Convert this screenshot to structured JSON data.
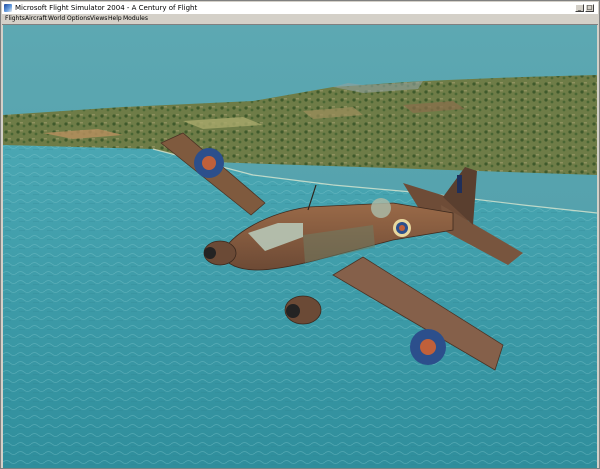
{
  "window": {
    "title": "Microsoft Flight Simulator 2004 - A Century of Flight",
    "controls": {
      "minimize": "_",
      "maximize": "□",
      "close": "×"
    }
  },
  "menu": {
    "items": [
      "Flights",
      "Aircraft",
      "World",
      "Options",
      "Views",
      "Help",
      "Modules"
    ]
  },
  "colors": {
    "sky": "#5aa6ae",
    "sea": "#3f9fab",
    "land": "#6b7a45",
    "aircraft": "#8a5a3c",
    "roundel_outer": "#2c4f8c",
    "roundel_inner": "#c0603a"
  }
}
